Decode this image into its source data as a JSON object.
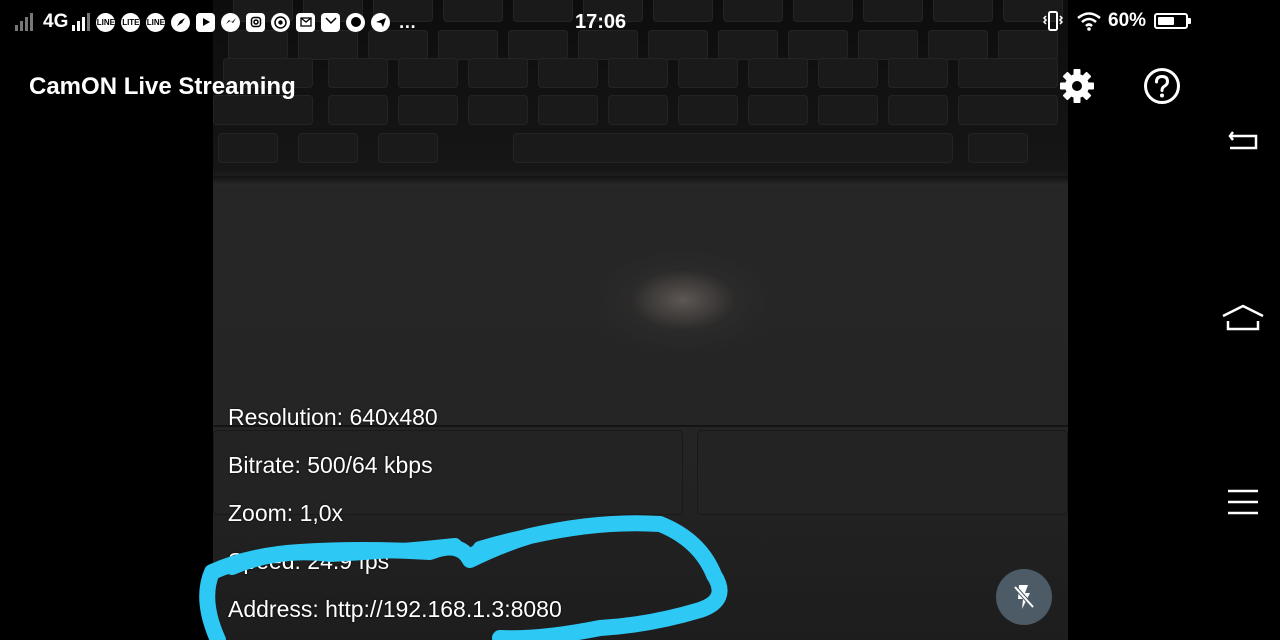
{
  "status_bar": {
    "network": "4G",
    "time": "17:06",
    "battery_percent": "60%",
    "battery_level": 0.6,
    "notification_icons": [
      "line-icon",
      "line-icon",
      "line-icon",
      "compass-icon",
      "youtube-icon",
      "messenger-icon",
      "instagram-icon",
      "chrome-icon",
      "gmail-icon",
      "mail-icon",
      "chat-bubble-icon",
      "telegram-icon"
    ],
    "icon_texts": {
      "line1": "LINE",
      "line2": "LITE",
      "line3": "LINE"
    },
    "more": "…"
  },
  "app_bar": {
    "title": "CamON Live Streaming",
    "icons": [
      "gear-icon",
      "help-icon"
    ]
  },
  "stream_info": {
    "resolution": "Resolution: 640x480",
    "bitrate": "Bitrate: 500/64 kbps",
    "zoom": "Zoom: 1,0x",
    "speed": "Speed: 24.9 fps",
    "address": "Address: http://192.168.1.3:8080"
  },
  "annotation": {
    "color": "#2ec8f5"
  },
  "flash_button": {
    "icon": "flash-off-icon",
    "color": "#4d5b66"
  },
  "nav_bar": {
    "icons": [
      "back-icon",
      "home-icon",
      "menu-icon"
    ]
  }
}
